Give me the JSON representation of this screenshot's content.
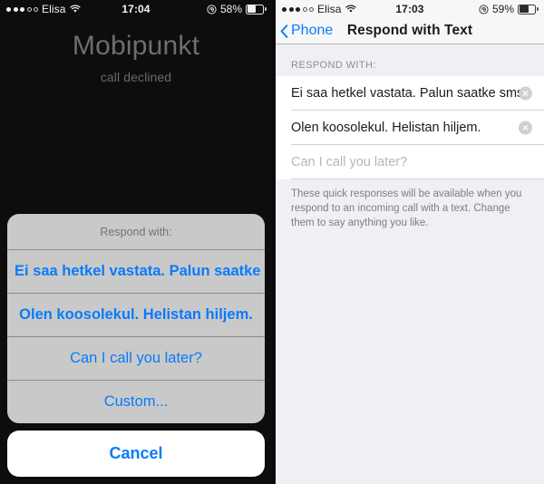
{
  "colors": {
    "ios_blue": "#0a7bfb",
    "sheet_bg": "#c9c9c9",
    "settings_bg": "#efeff4",
    "nav_bg": "#f7f7f7",
    "row_bg": "#ffffff",
    "placeholder_gray": "#b6b6bb",
    "header_gray": "#8d8d93",
    "call_text_gray": "#6e6e6e",
    "call_bg": "#0d0d0d"
  },
  "left_panel": {
    "status_bar": {
      "signal_dots": [
        true,
        true,
        true,
        false,
        false
      ],
      "carrier": "Elisa",
      "wifi_icon": "wifi-icon",
      "time": "17:04",
      "lock_icon": "rotation-lock-icon",
      "battery_percent": "58%",
      "battery_level": 58
    },
    "call": {
      "caller_name": "Mobipunkt",
      "status": "call declined"
    },
    "action_sheet": {
      "title": "Respond with:",
      "options": [
        {
          "label": "Ei saa hetkel vastata. Palun saatke sms.",
          "bold": true
        },
        {
          "label": "Olen koosolekul. Helistan hiljem.",
          "bold": true
        },
        {
          "label": "Can I call you later?",
          "bold": false
        },
        {
          "label": "Custom...",
          "bold": false
        }
      ],
      "cancel_label": "Cancel"
    }
  },
  "right_panel": {
    "status_bar": {
      "signal_dots": [
        true,
        true,
        true,
        false,
        false
      ],
      "carrier": "Elisa",
      "wifi_icon": "wifi-icon",
      "time": "17:03",
      "lock_icon": "rotation-lock-icon",
      "battery_percent": "59%",
      "battery_level": 59
    },
    "navbar": {
      "back_icon": "chevron-left-icon",
      "back_label": "Phone",
      "title": "Respond with Text"
    },
    "section": {
      "header": "RESPOND WITH:",
      "rows": [
        {
          "value": "Ei saa hetkel vastata. Palun saatke sms.",
          "placeholder": "",
          "is_placeholder": false,
          "has_clear": true
        },
        {
          "value": "Olen koosolekul. Helistan hiljem.",
          "placeholder": "",
          "is_placeholder": false,
          "has_clear": true
        },
        {
          "value": "Can I call you later?",
          "placeholder": "Can I call you later?",
          "is_placeholder": true,
          "has_clear": false
        }
      ],
      "footer": "These quick responses will be available when you respond to an incoming call with a text. Change them to say anything you like."
    }
  }
}
